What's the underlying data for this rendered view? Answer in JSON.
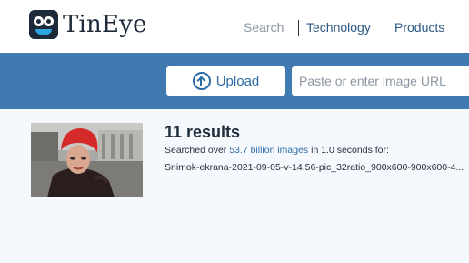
{
  "header": {
    "logo_text": "TinEye",
    "nav": [
      {
        "label": "Search"
      },
      {
        "label": "Technology"
      },
      {
        "label": "Products"
      }
    ]
  },
  "search": {
    "upload_label": "Upload",
    "url_placeholder": "Paste or enter image URL",
    "url_value": ""
  },
  "results": {
    "count_text": "11 results",
    "searched_prefix": "Searched over ",
    "index_size": "53.7 billion images",
    "searched_suffix": " in 1.0 seconds for:",
    "filename": "Snimok-ekrana-2021-09-05-v-14.56-pic_32ratio_900x600-900x600-4..."
  },
  "colors": {
    "band": "#3f7ab0",
    "accent": "#2d6ca6",
    "nav_active": "#8a96a4",
    "nav": "#2d5a86"
  },
  "icons": {
    "upload": "upload-arrow-icon",
    "logo": "tineye-robot-logo"
  }
}
